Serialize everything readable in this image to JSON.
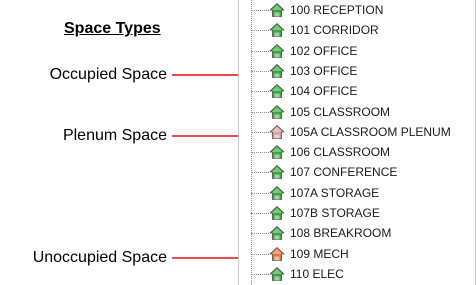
{
  "legend": {
    "title": "Space Types",
    "occupied_label": "Occupied Space",
    "plenum_label": "Plenum Space",
    "unoccupied_label": "Unoccupied Space",
    "arrow_color": "#e01010"
  },
  "space_tree": {
    "items": [
      {
        "label": "100 RECEPTION",
        "type": "occupied"
      },
      {
        "label": "101 CORRIDOR",
        "type": "occupied"
      },
      {
        "label": "102 OFFICE",
        "type": "occupied"
      },
      {
        "label": "103 OFFICE",
        "type": "occupied"
      },
      {
        "label": "104 OFFICE",
        "type": "occupied"
      },
      {
        "label": "105 CLASSROOM",
        "type": "occupied"
      },
      {
        "label": "105A CLASSROOM PLENUM",
        "type": "plenum"
      },
      {
        "label": "106 CLASSROOM",
        "type": "occupied"
      },
      {
        "label": "107 CONFERENCE",
        "type": "occupied"
      },
      {
        "label": "107A STORAGE",
        "type": "occupied"
      },
      {
        "label": "107B STORAGE",
        "type": "occupied"
      },
      {
        "label": "108 BREAKROOM",
        "type": "occupied"
      },
      {
        "label": "109 MECH",
        "type": "unoccupied"
      },
      {
        "label": "110 ELEC",
        "type": "occupied"
      }
    ]
  },
  "colors": {
    "occupied_icon": "#3aa640",
    "plenum_icon": "#d9a0a0",
    "unoccupied_icon": "#e07a3a"
  }
}
